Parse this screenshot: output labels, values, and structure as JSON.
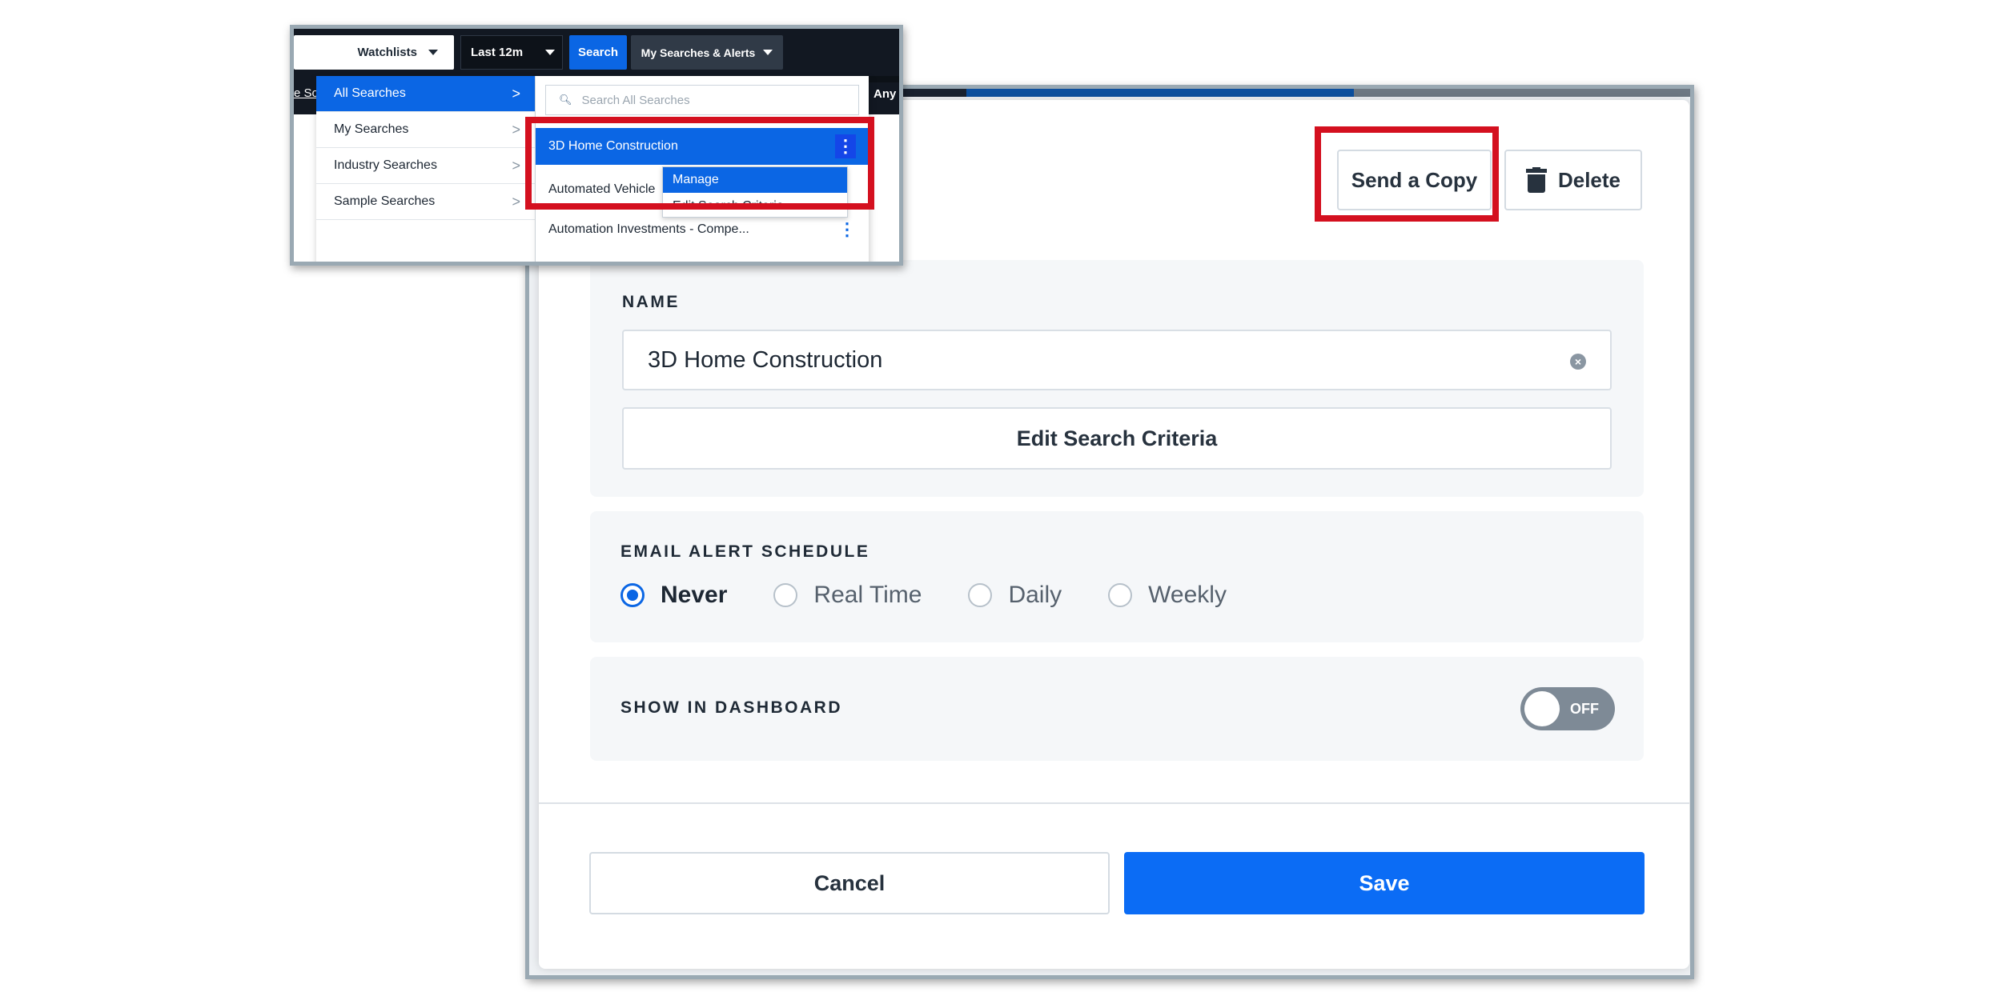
{
  "inset": {
    "topbar": {
      "watchlists": "Watchlists",
      "range": "Last 12m",
      "search": "Search",
      "my_searches": "My Searches & Alerts"
    },
    "subbar": {
      "left_fragment": "e So",
      "right_fragment": "Any"
    },
    "menu_left": [
      {
        "label": "All Searches",
        "active": true
      },
      {
        "label": "My Searches",
        "active": false
      },
      {
        "label": "Industry Searches",
        "active": false
      },
      {
        "label": "Sample Searches",
        "active": false
      }
    ],
    "search_placeholder": "Search All Searches",
    "results": [
      "3D Home Construction",
      "Automated Vehicle",
      "Automation Investments - Compe..."
    ],
    "row_menu": {
      "manage": "Manage",
      "edit": "Edit Search Criteria"
    }
  },
  "modal": {
    "send_copy": "Send a Copy",
    "delete": "Delete",
    "name_label": "NAME",
    "name_value": "3D Home Construction",
    "edit_criteria": "Edit Search Criteria",
    "email_label": "EMAIL ALERT SCHEDULE",
    "schedule_options": [
      "Never",
      "Real Time",
      "Daily",
      "Weekly"
    ],
    "schedule_selected": "Never",
    "dashboard_label": "SHOW IN DASHBOARD",
    "dashboard_toggle": "OFF",
    "cancel": "Cancel",
    "save": "Save"
  },
  "colors": {
    "accent": "#0b66e4",
    "highlight": "#d4101f",
    "topbar": "#121822"
  }
}
